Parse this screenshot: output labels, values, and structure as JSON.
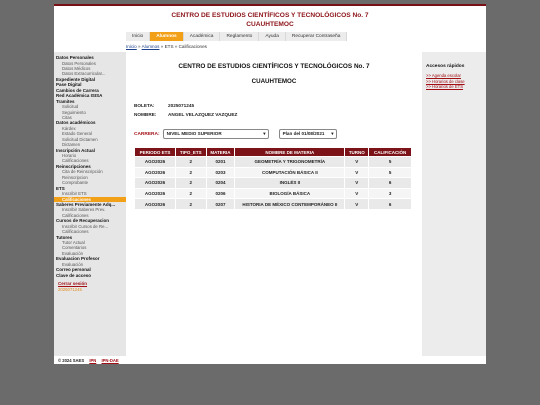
{
  "header": {
    "title_line1": "CENTRO DE ESTUDIOS CIENTÍFICOS Y TECNOLÓGICOS No. 7",
    "title_line2": "CUAUHTEMOC"
  },
  "menu": [
    "Inicio",
    "Alumnos",
    "Académica",
    "Reglamento",
    "Ayuda",
    "Recuperar Contraseña"
  ],
  "breadcrumb": {
    "inicio": "Inicio",
    "sep1": " » ",
    "alumnos": "Alumnos",
    "rest": " » ETS » Calificaciones"
  },
  "sidebar": {
    "items": [
      {
        "text": "Datos Personales",
        "type": "sec"
      },
      {
        "text": "Datos Personales",
        "type": "sub"
      },
      {
        "text": "Datos Médicos",
        "type": "sub"
      },
      {
        "text": "Datos Extracurricular...",
        "type": "sub"
      },
      {
        "text": "Expediente Digital",
        "type": "sec"
      },
      {
        "text": "Pase Digital",
        "type": "sec"
      },
      {
        "text": "Cambios de Carrera",
        "type": "sec"
      },
      {
        "text": "Red Académica ISISA",
        "type": "sec"
      },
      {
        "text": "Tramites",
        "type": "sec"
      },
      {
        "text": "Solicitud",
        "type": "sub"
      },
      {
        "text": "Seguimiento",
        "type": "sub"
      },
      {
        "text": "Citas",
        "type": "sub"
      },
      {
        "text": "Datos académicos",
        "type": "sec"
      },
      {
        "text": "Kárdex",
        "type": "sub"
      },
      {
        "text": "Estado General",
        "type": "sub"
      },
      {
        "text": "Solicitud Dictamen",
        "type": "sub"
      },
      {
        "text": "Dictamen",
        "type": "sub"
      },
      {
        "text": "Inscripción Actual",
        "type": "sec"
      },
      {
        "text": "Horario",
        "type": "sub"
      },
      {
        "text": "Calificaciones",
        "type": "sub"
      },
      {
        "text": "Reinscripciones",
        "type": "sec"
      },
      {
        "text": "Cita de Reinscripción",
        "type": "sub"
      },
      {
        "text": "Reinscripcion",
        "type": "sub"
      },
      {
        "text": "Comprobante",
        "type": "sub"
      },
      {
        "text": "ETS",
        "type": "sec"
      },
      {
        "text": "Inscribir ETS",
        "type": "sub"
      },
      {
        "text": "Calificaciones",
        "type": "sub",
        "active": true
      },
      {
        "text": "Saberes Previamente Adq...",
        "type": "sec"
      },
      {
        "text": "Inscribir Saberes Prev.",
        "type": "sub"
      },
      {
        "text": "Calificaciones",
        "type": "sub"
      },
      {
        "text": "Cursos de Recuperacion",
        "type": "sec"
      },
      {
        "text": "Inscribir Cursos de Re...",
        "type": "sub"
      },
      {
        "text": "Calificaciones",
        "type": "sub"
      },
      {
        "text": "Tutores",
        "type": "sec"
      },
      {
        "text": "Tutor Actual",
        "type": "sub"
      },
      {
        "text": "Comentarios",
        "type": "sub"
      },
      {
        "text": "Evaluación",
        "type": "sub"
      },
      {
        "text": "Evaluacion Profesor",
        "type": "sec"
      },
      {
        "text": "Evaluación",
        "type": "sub"
      },
      {
        "text": "Correo personal",
        "type": "sec"
      },
      {
        "text": "Clave de acceso",
        "type": "sec"
      }
    ],
    "logout": "Cerrar sesión",
    "logout_user": "2025071245"
  },
  "main": {
    "school_title": "CENTRO DE ESTUDIOS CIENTÍFICOS Y TECNOLÓGICOS No. 7",
    "school_sub": "CUAUHTEMOC",
    "boleta_label": "BOLETA:",
    "boleta_value": "2025071245",
    "nombre_label": "NOMBRE:",
    "nombre_value": "ANGEL VELAZQUEZ VAZQUEZ",
    "carrera_label": "CARRERA:",
    "carrera_value": "NIVEL MEDIO SUPERIOR",
    "plan_value": "Plan del 01/08/2021",
    "table": {
      "headers": [
        "PERIODO ETS",
        "TIPO_ETS",
        "MATERIA",
        "NOMBRE DE MATERIA",
        "TURNO",
        "CALIFICACIÓN"
      ],
      "rows": [
        [
          "AGO2026",
          "2",
          "0201",
          "GEOMETRÍA Y TRIGONOMETRÍA",
          "V",
          "5"
        ],
        [
          "AGO2026",
          "2",
          "0203",
          "COMPUTACIÓN BÁSICA II",
          "V",
          "5"
        ],
        [
          "AGO2026",
          "2",
          "0204",
          "INGLÉS II",
          "V",
          "6"
        ],
        [
          "AGO2026",
          "2",
          "0206",
          "BIOLOGÍA BÁSICA",
          "V",
          "3"
        ],
        [
          "AGO2026",
          "2",
          "0207",
          "HISTORIA DE MÉXICO CONTEMPORÁNEO II",
          "V",
          "6"
        ]
      ]
    }
  },
  "quick": {
    "title": "Accesos rápidos",
    "links": [
      ">> Agenda escolar",
      ">> Horarios de clase",
      ">> Horarios de ETS"
    ]
  },
  "footer": {
    "copyright": "© 2024 SAES",
    "link1": "IPN",
    "link2": "IPN-DAE"
  }
}
